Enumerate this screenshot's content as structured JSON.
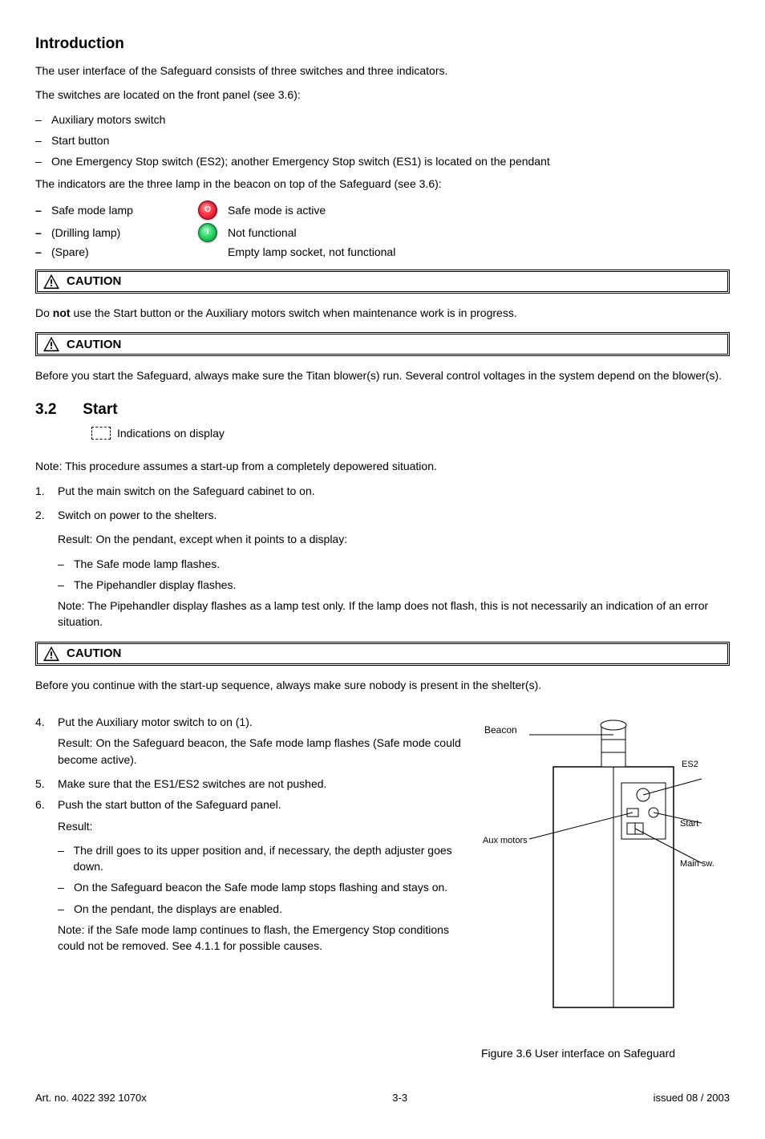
{
  "intro": {
    "heading": "Introduction",
    "ui_p1": "The user interface of the Safeguard consists of three switches and three indicators.",
    "ui_p2": "The switches are located on the front panel (see 3.6):",
    "switches": [
      "Auxiliary motors switch",
      "Start button",
      "One Emergency Stop switch (ES2); another Emergency Stop switch (ES1) is located on the pendant"
    ],
    "ind_p": "The indicators are the three lamp in the beacon on top of the Safeguard (see 3.6):",
    "lamps": [
      {
        "label": "Safe mode lamp",
        "color": "red",
        "glyph": "O",
        "desc": "Safe mode is active"
      },
      {
        "label": "(Drilling lamp)",
        "color": "green",
        "glyph": "I",
        "desc": "Not functional"
      },
      {
        "label": "(Spare)",
        "color": "",
        "glyph": "",
        "desc": "Empty lamp socket, not functional"
      }
    ]
  },
  "caution1": {
    "title": "CAUTION",
    "body_prefix": "Do",
    "body_bold": " not",
    "body_suffix": " use the Start button or the Auxiliary motors switch when maintenance work is in progress."
  },
  "caution2": {
    "title": "CAUTION",
    "body": "Before you start the Safeguard, always make sure the Titan blower(s) run. Several control voltages in the system depend on the blower(s)."
  },
  "sec_start": {
    "num": "3.2",
    "title": "Start",
    "dashed_caption": "Indications on display",
    "steps": [
      "Note: This procedure assumes a start-up from a completely depowered situation.",
      "Put the main switch on the Safeguard cabinet to on.",
      "Switch on power to the shelters."
    ],
    "result_lead": "Result: On the pendant, except when it points to a display:",
    "result_items": [
      "The Safe mode lamp flashes.",
      "The Pipehandler display flashes."
    ],
    "note_text": "Note: The Pipehandler display flashes as a lamp test only. If the lamp does not flash, this is not necessarily an indication of an error situation."
  },
  "caution3": {
    "title": "CAUTION",
    "body": "Before you continue with the start-up sequence, always make sure nobody is present in the shelter(s)."
  },
  "cap_steps": {
    "cap4": "Put the Auxiliary motor switch to on (1).",
    "result4": "Result: On the Safeguard beacon, the Safe mode lamp flashes (Safe mode could become active).",
    "cap5": "Make sure that the ES1/ES2 switches are not pushed.",
    "cap6": "Push the start button of the Safeguard panel.",
    "result6_lead": "Result:",
    "result6_items": [
      "The drill goes to its upper position and, if necessary, the depth adjuster goes down.",
      "On the Safeguard beacon the Safe mode lamp stops flashing and stays on.",
      "On the pendant, the displays are enabled."
    ],
    "note6": "Note: if the Safe mode lamp continues to flash, the Emergency Stop conditions could not be removed. See 4.1.1 for possible causes."
  },
  "figure": {
    "caption": "Figure 3.6 User interface on Safeguard",
    "labels": {
      "beacon": "Beacon",
      "estop": "Emergency stop switch (ES2)",
      "aux": "Auxiliary motors switch",
      "start": "Start button",
      "main": "Main switch"
    }
  },
  "footer": {
    "left": "Art. no. 4022 392 1070x",
    "center": "3-3",
    "right": "issued 08 / 2003"
  }
}
